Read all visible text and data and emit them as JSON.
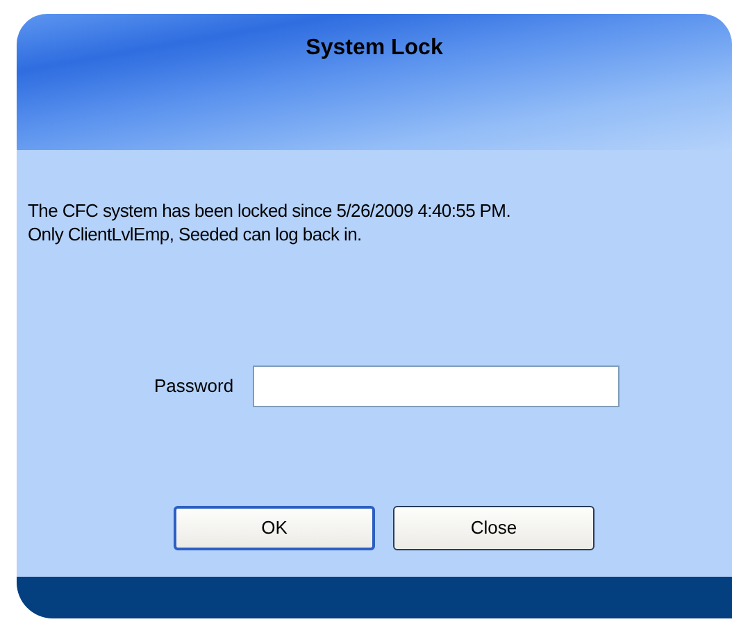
{
  "window": {
    "title": "System Lock"
  },
  "message": [
    "The CFC system has been locked since 5/26/2009 4:40:55 PM.",
    "Only ClientLvlEmp, Seeded can log back in."
  ],
  "password": {
    "label": "Password"
  },
  "buttons": [
    {
      "label": "OK",
      "default": true
    },
    {
      "label": "Close",
      "default": false
    }
  ]
}
